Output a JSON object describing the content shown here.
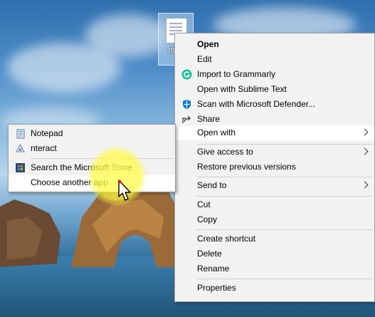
{
  "desktop": {
    "file_label": "myn"
  },
  "context_menu": {
    "items": [
      {
        "label": "Open",
        "bold": true
      },
      {
        "label": "Edit"
      },
      {
        "label": "Import to Grammarly",
        "icon": "grammarly-icon"
      },
      {
        "label": "Open with Sublime Text"
      },
      {
        "label": "Scan with Microsoft Defender...",
        "icon": "defender-shield-icon"
      },
      {
        "label": "Share",
        "icon": "share-icon"
      },
      {
        "label": "Open with",
        "submenu": true,
        "highlighted": true
      },
      {
        "label": "Give access to",
        "submenu": true
      },
      {
        "label": "Restore previous versions"
      },
      {
        "label": "Send to",
        "submenu": true
      },
      {
        "label": "Cut"
      },
      {
        "label": "Copy"
      },
      {
        "label": "Create shortcut"
      },
      {
        "label": "Delete"
      },
      {
        "label": "Rename"
      },
      {
        "label": "Properties"
      }
    ]
  },
  "open_with_submenu": {
    "items": [
      {
        "label": "Notepad",
        "icon": "notepad-icon"
      },
      {
        "label": "nteract",
        "icon": "nteract-icon"
      },
      {
        "label": "Search the Microsoft Store",
        "icon": "microsoft-store-icon"
      },
      {
        "label": "Choose another app",
        "highlighted": true
      }
    ]
  },
  "colors": {
    "menu_bg": "#f2f2f2",
    "highlight_item": "#ffffff",
    "grammarly": "#15c39a",
    "defender": "#0078d4",
    "cursor_highlight": "#ffff5a"
  }
}
